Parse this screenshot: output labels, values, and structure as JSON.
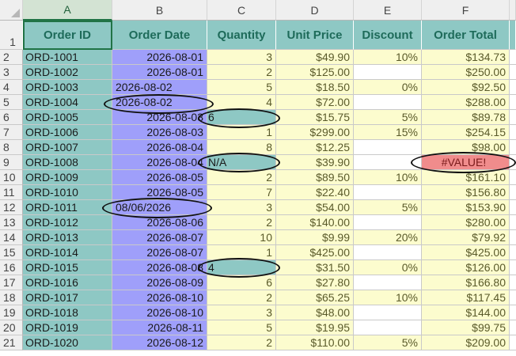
{
  "columns": [
    "A",
    "B",
    "C",
    "D",
    "E",
    "F"
  ],
  "header_row_number": "1",
  "headers": [
    "Order ID",
    "Order Date",
    "Quantity",
    "Unit Price",
    "Discount",
    "Order Total"
  ],
  "rows": [
    {
      "n": "2",
      "id": "ORD-1001",
      "date": "2026-08-01",
      "qty": "3",
      "price": "$49.90",
      "disc": "10%",
      "total": "$134.73"
    },
    {
      "n": "3",
      "id": "ORD-1002",
      "date": "2026-08-01",
      "qty": "2",
      "price": "$125.00",
      "disc": "",
      "total": "$250.00"
    },
    {
      "n": "4",
      "id": "ORD-1003",
      "date": "2026-08-02",
      "qty": "5",
      "price": "$18.50",
      "disc": "0%",
      "total": "$92.50"
    },
    {
      "n": "5",
      "id": "ORD-1004",
      "date": "2026-08-02",
      "qty": "4",
      "price": "$72.00",
      "disc": "",
      "total": "$288.00"
    },
    {
      "n": "6",
      "id": "ORD-1005",
      "date": "2026-08-03",
      "qty": "6",
      "price": "$15.75",
      "disc": "5%",
      "total": "$89.78"
    },
    {
      "n": "7",
      "id": "ORD-1006",
      "date": "2026-08-03",
      "qty": "1",
      "price": "$299.00",
      "disc": "15%",
      "total": "$254.15"
    },
    {
      "n": "8",
      "id": "ORD-1007",
      "date": "2026-08-04",
      "qty": "8",
      "price": "$12.25",
      "disc": "",
      "total": "$98.00"
    },
    {
      "n": "9",
      "id": "ORD-1008",
      "date": "2026-08-04",
      "qty": "N/A",
      "price": "$39.90",
      "disc": "",
      "total": "#VALUE!"
    },
    {
      "n": "10",
      "id": "ORD-1009",
      "date": "2026-08-05",
      "qty": "2",
      "price": "$89.50",
      "disc": "10%",
      "total": "$161.10"
    },
    {
      "n": "11",
      "id": "ORD-1010",
      "date": "2026-08-05",
      "qty": "7",
      "price": "$22.40",
      "disc": "",
      "total": "$156.80"
    },
    {
      "n": "12",
      "id": "ORD-1011",
      "date": "08/06/2026",
      "qty": "3",
      "price": "$54.00",
      "disc": "5%",
      "total": "$153.90"
    },
    {
      "n": "13",
      "id": "ORD-1012",
      "date": "2026-08-06",
      "qty": "2",
      "price": "$140.00",
      "disc": "",
      "total": "$280.00"
    },
    {
      "n": "14",
      "id": "ORD-1013",
      "date": "2026-08-07",
      "qty": "10",
      "price": "$9.99",
      "disc": "20%",
      "total": "$79.92"
    },
    {
      "n": "15",
      "id": "ORD-1014",
      "date": "2026-08-07",
      "qty": "1",
      "price": "$425.00",
      "disc": "",
      "total": "$425.00"
    },
    {
      "n": "16",
      "id": "ORD-1015",
      "date": "2026-08-08",
      "qty": "4",
      "price": "$31.50",
      "disc": "0%",
      "total": "$126.00"
    },
    {
      "n": "17",
      "id": "ORD-1016",
      "date": "2026-08-09",
      "qty": "6",
      "price": "$27.80",
      "disc": "",
      "total": "$166.80"
    },
    {
      "n": "18",
      "id": "ORD-1017",
      "date": "2026-08-10",
      "qty": "2",
      "price": "$65.25",
      "disc": "10%",
      "total": "$117.45"
    },
    {
      "n": "19",
      "id": "ORD-1018",
      "date": "2026-08-10",
      "qty": "3",
      "price": "$48.00",
      "disc": "",
      "total": "$144.00"
    },
    {
      "n": "20",
      "id": "ORD-1019",
      "date": "2026-08-11",
      "qty": "5",
      "price": "$19.95",
      "disc": "",
      "total": "$99.75"
    },
    {
      "n": "21",
      "id": "ORD-1020",
      "date": "2026-08-12",
      "qty": "2",
      "price": "$110.00",
      "disc": "5%",
      "total": "$209.00"
    }
  ],
  "cell_styles": {
    "left_aligned_dates": [
      "2026-08-02",
      "08/06/2026"
    ],
    "teal_quantity_rows": [
      "6",
      "9",
      "16"
    ],
    "blank_discount_fill": "#ffffff"
  },
  "colors": {
    "header_fill": "#8ec8c4",
    "header_text": "#1e6b5a",
    "order_id_fill": "#8ec8c4",
    "date_fill": "#9f9ffa",
    "numeric_fill": "#fcfcce",
    "error_fill": "#f08c8c"
  }
}
